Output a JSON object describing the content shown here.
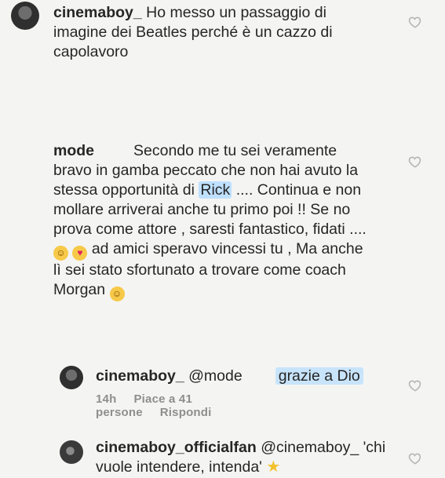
{
  "comments": [
    {
      "username": "cinemaboy_",
      "line1": " Ho messo un passaggio di",
      "line2": "imagine dei Beatles perché è un cazzo di",
      "line3": "capolavoro"
    },
    {
      "username": "mode",
      "line1": "Secondo me tu sei veramente",
      "line2": "bravo in gamba peccato che non hai avuto la",
      "line3a": "stessa opportunità di ",
      "line3hl": "Rick",
      "line3b": " .... Continua e non",
      "line4": "mollare arriverai anche tu primo poi !! Se no",
      "line5": "prova come attore , saresti fantastico, fidati ....",
      "line6": " ad amici speravo vincessi tu , Ma anche",
      "line7": "lì sei stato sfortunato a trovare come coach",
      "line8": "Morgan "
    },
    {
      "username": "cinemaboy_",
      "mention": " @mode",
      "reply": "grazie a Dio",
      "time": "14h",
      "likes": "Piace a 41 persone",
      "reply_action": "Rispondi"
    },
    {
      "username": "cinemaboy_officialfan",
      "line1": " @cinemaboy_ 'chi",
      "line2": "vuole intendere, intenda' "
    }
  ],
  "icons": {
    "heart": "heart-outline-icon",
    "emoji_relieved": "relieved-face-icon",
    "emoji_hearteyes": "heart-eyes-face-icon",
    "emoji_star": "star-icon"
  },
  "colors": {
    "background": "#f4f4f2",
    "text": "#262626",
    "meta": "#8e8e8e",
    "highlight": "#bfe0ff"
  }
}
